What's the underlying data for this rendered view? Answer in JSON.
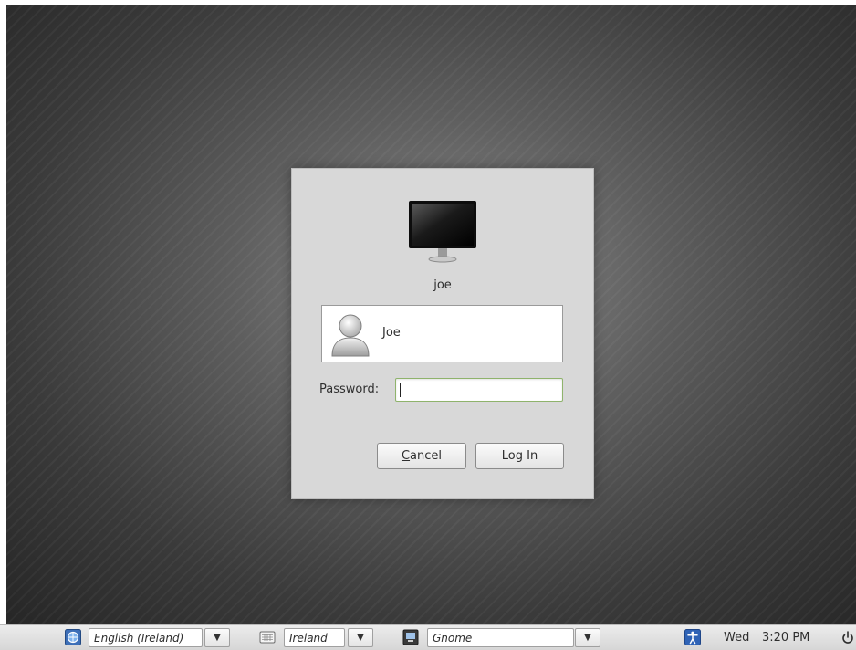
{
  "login_dialog": {
    "host_name": "joe",
    "users": [
      {
        "display_name": "Joe"
      }
    ],
    "password_label": "Password:",
    "password_value": "",
    "cancel_label": "ancel",
    "cancel_mnemonic": "C",
    "login_label": "Log In"
  },
  "panel": {
    "language": {
      "icon": "language-globe-icon",
      "value": "English (Ireland)"
    },
    "keyboard": {
      "icon": "keyboard-icon",
      "value": "Ireland"
    },
    "session": {
      "icon": "session-icon",
      "value": "Gnome"
    },
    "accessibility_icon": "accessibility-icon",
    "clock": {
      "day": "Wed",
      "time": "3:20 PM"
    },
    "power_icon": "power-icon",
    "dropdown_glyph": "▼"
  },
  "colors": {
    "dialog_bg": "#d8d8d8",
    "panel_bg": "#dedede",
    "focus_border": "#8fb36c"
  }
}
